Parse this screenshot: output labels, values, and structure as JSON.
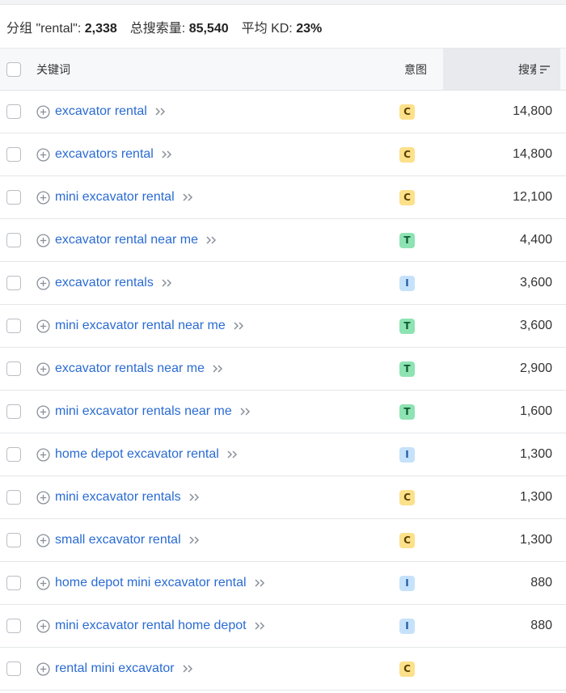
{
  "summary": {
    "group_label": "分组 \"rental\":",
    "group_count": "2,338",
    "total_label": "总搜索量:",
    "total_value": "85,540",
    "kd_label": "平均 KD:",
    "kd_value": "23%"
  },
  "table": {
    "headers": {
      "keyword": "关键词",
      "intent": "意图",
      "volume": "搜索量"
    },
    "rows": [
      {
        "keyword": "excavator rental",
        "intent": "C",
        "volume": "14,800"
      },
      {
        "keyword": "excavators rental",
        "intent": "C",
        "volume": "14,800"
      },
      {
        "keyword": "mini excavator rental",
        "intent": "C",
        "volume": "12,100"
      },
      {
        "keyword": "excavator rental near me",
        "intent": "T",
        "volume": "4,400"
      },
      {
        "keyword": "excavator rentals",
        "intent": "I",
        "volume": "3,600"
      },
      {
        "keyword": "mini excavator rental near me",
        "intent": "T",
        "volume": "3,600"
      },
      {
        "keyword": "excavator rentals near me",
        "intent": "T",
        "volume": "2,900"
      },
      {
        "keyword": "mini excavator rentals near me",
        "intent": "T",
        "volume": "1,600"
      },
      {
        "keyword": "home depot excavator rental",
        "intent": "I",
        "volume": "1,300"
      },
      {
        "keyword": "mini excavator rentals",
        "intent": "C",
        "volume": "1,300"
      },
      {
        "keyword": "small excavator rental",
        "intent": "C",
        "volume": "1,300"
      },
      {
        "keyword": "home depot mini excavator rental",
        "intent": "I",
        "volume": "880"
      },
      {
        "keyword": "mini excavator rental home depot",
        "intent": "I",
        "volume": "880"
      },
      {
        "keyword": "rental mini excavator",
        "intent": "C",
        "volume": ""
      }
    ]
  },
  "colors": {
    "link": "#2a6bd2",
    "intent_commercial": "#fce08a",
    "intent_transactional": "#8ee3b2",
    "intent_informational": "#c6e2fb"
  },
  "icons": {
    "row_add": "plus-circle-icon",
    "row_open": "double-chevron-right-icon",
    "sort": "sort-descending-icon"
  }
}
